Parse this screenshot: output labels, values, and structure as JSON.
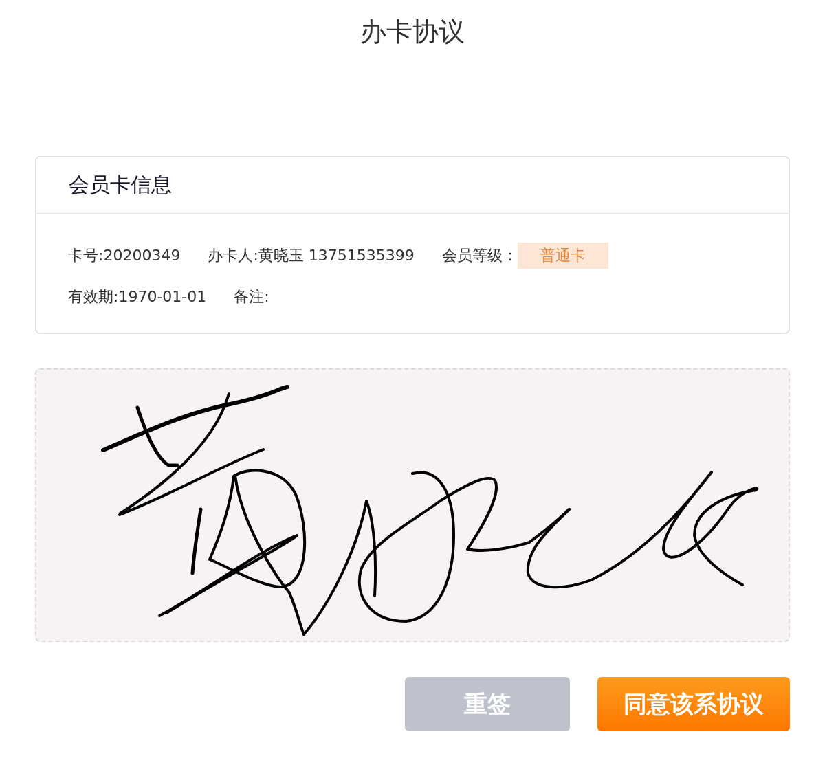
{
  "title": "办卡协议",
  "card": {
    "heading": "会员卡信息",
    "rows": [
      [
        {
          "kind": "text",
          "text": "卡号:20200349"
        },
        {
          "kind": "text",
          "text": "办卡人:黄晓玉 13751535399"
        },
        {
          "kind": "text",
          "text": "会员等级："
        },
        {
          "kind": "tag",
          "text": "普通卡"
        }
      ],
      [
        {
          "kind": "text",
          "text": "有效期:1970-01-01"
        },
        {
          "kind": "text",
          "text": "备注:"
        }
      ]
    ]
  },
  "buttons": [
    {
      "kind": "secondary",
      "label": "重签"
    },
    {
      "kind": "primary",
      "label": "同意该系协议"
    }
  ]
}
